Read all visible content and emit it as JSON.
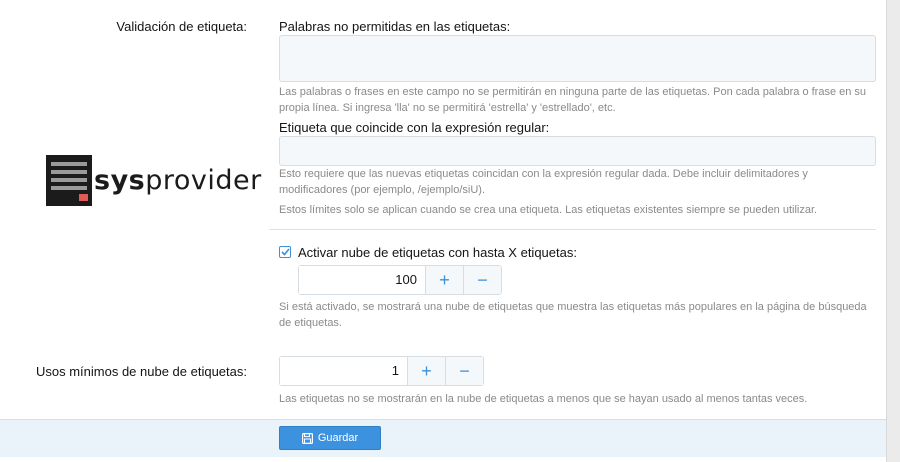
{
  "tag_validation": {
    "row_label": "Validación de etiqueta:",
    "disallowed_label": "Palabras no permitidas en las etiquetas:",
    "disallowed_value": "",
    "disallowed_hint": "Las palabras o frases en este campo no se permitirán en ninguna parte de las etiquetas. Pon cada palabra o frase en su propia línea. Si ingresa 'lla' no se permitirá 'estrella' y 'estrellado', etc.",
    "regex_label": "Etiqueta que coincide con la expresión regular:",
    "regex_value": "",
    "regex_hint": "Esto requiere que las nuevas etiquetas coincidan con la expresión regular dada. Debe incluir delimitadores y modificadores (por ejemplo, /ejemplo/siU).",
    "limits_hint": "Estos límites solo se aplican cuando se crea una etiqueta. Las etiquetas existentes siempre se pueden utilizar."
  },
  "tag_cloud": {
    "checkbox_label": "Activar nube de etiquetas con hasta X etiquetas:",
    "checked": true,
    "max_tags": "100",
    "hint": "Si está activado, se mostrará una nube de etiquetas que muestra las etiquetas más populares en la página de búsqueda de etiquetas."
  },
  "min_uses": {
    "row_label": "Usos mínimos de nube de etiquetas:",
    "value": "1",
    "hint": "Las etiquetas no se mostrarán en la nube de etiquetas a menos que se hayan usado al menos tantas veces."
  },
  "stepper": {
    "plus": "+",
    "minus": "−"
  },
  "footer": {
    "save_label": "Guardar"
  },
  "logo": {
    "text_bold": "sys",
    "text_regular": "provider"
  },
  "colors": {
    "accent": "#3d8fd6",
    "button": "#3d92e0",
    "logo_red": "#e05a5a"
  }
}
